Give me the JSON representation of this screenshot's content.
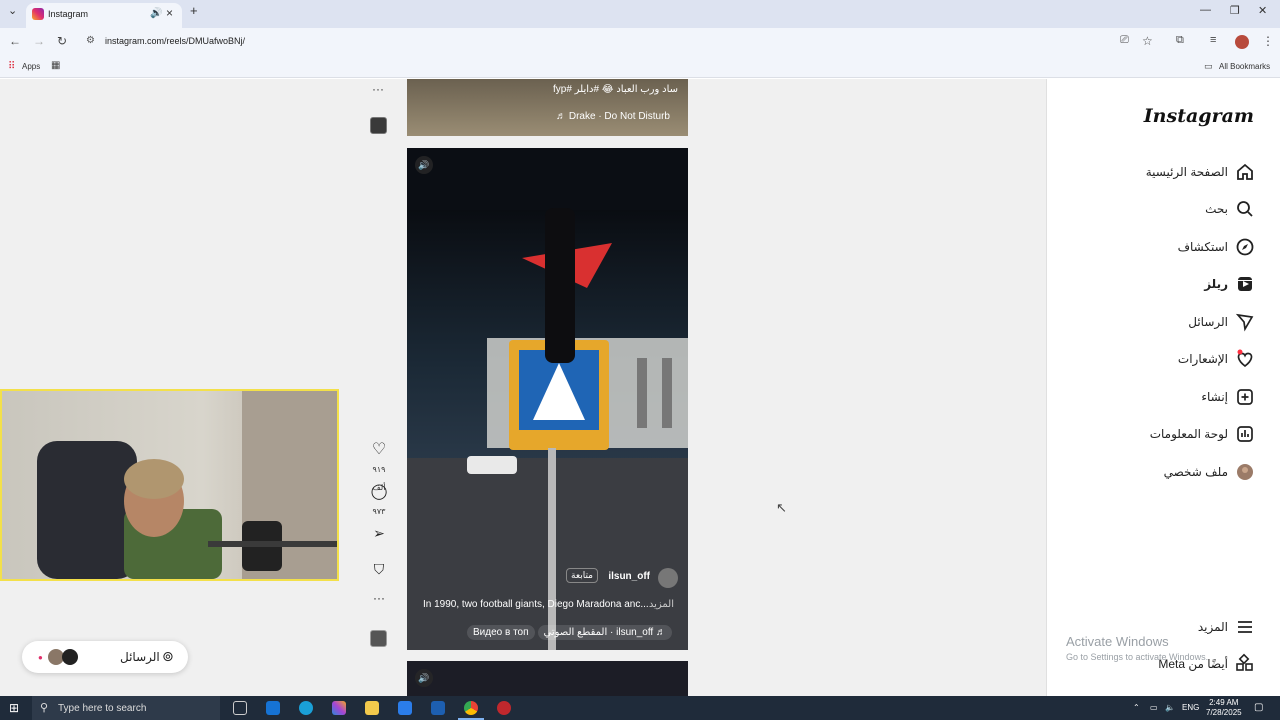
{
  "browser": {
    "tab_title": "Instagram",
    "new_tab": "+",
    "url": "instagram.com/reels/DMUafwoBNj/",
    "bookmarks": {
      "apps": "Apps",
      "all": "All Bookmarks"
    }
  },
  "instagram": {
    "logo": "Instagram",
    "nav": [
      {
        "label": "الصفحة الرئيسية",
        "icon": "home-icon"
      },
      {
        "label": "بحث",
        "icon": "search-icon"
      },
      {
        "label": "استكشاف",
        "icon": "compass-icon"
      },
      {
        "label": "ريلز",
        "icon": "reels-icon"
      },
      {
        "label": "الرسائل",
        "icon": "send-icon"
      },
      {
        "label": "الإشعارات",
        "icon": "heart-icon"
      },
      {
        "label": "إنشاء",
        "icon": "plus-icon"
      },
      {
        "label": "لوحة المعلومات",
        "icon": "dashboard-icon"
      },
      {
        "label": "ملف شخصي",
        "icon": "avatar-icon"
      }
    ],
    "more": {
      "label": "المزيد",
      "icon": "menu-icon"
    },
    "also_meta": {
      "label": "أيضًا من Meta",
      "icon": "meta-apps-icon"
    },
    "top_reel": {
      "caption": "ساد ورب العباد 😂 #دايلر #fyp",
      "music": "Drake · Do Not Disturb ♬"
    },
    "main_reel": {
      "username": "ilsun_off",
      "follow": "متابعة",
      "description": "In 1990, two football giants, Diego Maradona anc...",
      "more": "المزيد",
      "audio": "♬ ilsun_off · المقطع الصوتي",
      "location": "Видео в топ",
      "likes": "٩١٩ ألف",
      "comments": "٩٧٣"
    },
    "messages_pill": "الرسائل"
  },
  "windows": {
    "search_placeholder": "Type here to search",
    "activate_title": "Activate Windows",
    "activate_sub": "Go to Settings to activate Windows.",
    "tray_lang": "ENG",
    "tray_time": "2:49 AM",
    "tray_date": "7/28/2025"
  }
}
